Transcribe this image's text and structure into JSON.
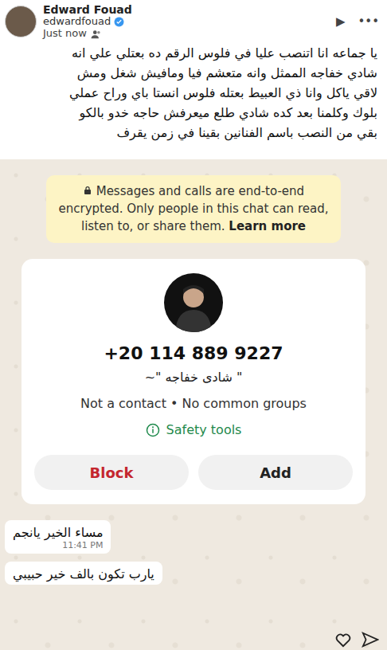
{
  "story": {
    "display_name": "Edward Fouad",
    "username": "edwardfouad",
    "verified": true,
    "time": "Just now",
    "play_icon": "▶",
    "more_icon": "•••"
  },
  "caption": {
    "lines": [
      "يا جماعه انا اتنصب عليا في فلوس الرقم ده بعتلي علي انه",
      "شادي خفاجه الممثل وانه متعشم فيا ومافيش شغل ومش",
      "لاقي ياكل وانا ذي العبيط بعتله فلوس انستا باي وراح عملي",
      "بلوك وكلمنا بعد كده شادي طلع ميعرفش حاجه خدو بالكو",
      "بقي من النصب باسم الفنانين بقينا في زمن يقرف"
    ]
  },
  "chat": {
    "encryption": {
      "text": "Messages and calls are end-to-end encrypted. Only people in this chat can read, listen to, or share them.",
      "link": "Learn more"
    },
    "contact": {
      "phone": "+20 114 889 9227",
      "name": "~\" شادى خفاجه \"",
      "info": "Not a contact • No common groups",
      "safety": "Safety tools",
      "buttons": [
        {
          "label": "Block",
          "kind": "danger"
        },
        {
          "label": "Add",
          "kind": "normal"
        }
      ]
    },
    "messages": [
      {
        "text": "مساء الخير يانجم",
        "time": "11:41 PM"
      },
      {
        "text": "يارب تكون بالف خير حبيبي"
      }
    ]
  }
}
